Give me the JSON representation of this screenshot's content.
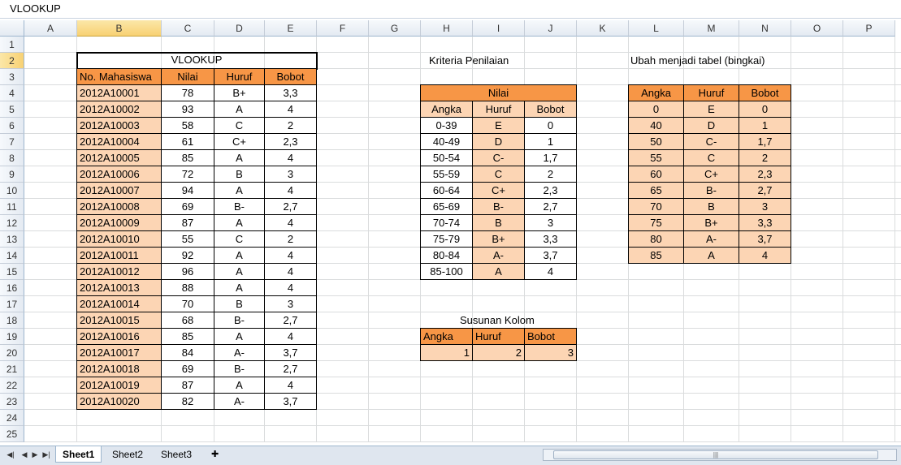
{
  "formula_bar": {
    "value": "VLOOKUP"
  },
  "columns": [
    "A",
    "B",
    "C",
    "D",
    "E",
    "F",
    "G",
    "H",
    "I",
    "J",
    "K",
    "L",
    "M",
    "N",
    "O",
    "P"
  ],
  "rows": [
    "1",
    "2",
    "3",
    "4",
    "5",
    "6",
    "7",
    "8",
    "9",
    "10",
    "11",
    "12",
    "13",
    "14",
    "15",
    "16",
    "17",
    "18",
    "19",
    "20",
    "21",
    "22",
    "23",
    "24",
    "25"
  ],
  "main_table": {
    "title": "VLOOKUP",
    "headers": [
      "No. Mahasiswa",
      "Nilai",
      "Huruf",
      "Bobot"
    ],
    "rows": [
      [
        "2012A10001",
        "78",
        "B+",
        "3,3"
      ],
      [
        "2012A10002",
        "93",
        "A",
        "4"
      ],
      [
        "2012A10003",
        "58",
        "C",
        "2"
      ],
      [
        "2012A10004",
        "61",
        "C+",
        "2,3"
      ],
      [
        "2012A10005",
        "85",
        "A",
        "4"
      ],
      [
        "2012A10006",
        "72",
        "B",
        "3"
      ],
      [
        "2012A10007",
        "94",
        "A",
        "4"
      ],
      [
        "2012A10008",
        "69",
        "B-",
        "2,7"
      ],
      [
        "2012A10009",
        "87",
        "A",
        "4"
      ],
      [
        "2012A10010",
        "55",
        "C",
        "2"
      ],
      [
        "2012A10011",
        "92",
        "A",
        "4"
      ],
      [
        "2012A10012",
        "96",
        "A",
        "4"
      ],
      [
        "2012A10013",
        "88",
        "A",
        "4"
      ],
      [
        "2012A10014",
        "70",
        "B",
        "3"
      ],
      [
        "2012A10015",
        "68",
        "B-",
        "2,7"
      ],
      [
        "2012A10016",
        "85",
        "A",
        "4"
      ],
      [
        "2012A10017",
        "84",
        "A-",
        "3,7"
      ],
      [
        "2012A10018",
        "69",
        "B-",
        "2,7"
      ],
      [
        "2012A10019",
        "87",
        "A",
        "4"
      ],
      [
        "2012A10020",
        "82",
        "A-",
        "3,7"
      ]
    ]
  },
  "criteria": {
    "title": "Kriteria Penilaian",
    "group_header": "Nilai",
    "headers": [
      "Angka",
      "Huruf",
      "Bobot"
    ],
    "rows": [
      [
        "0-39",
        "E",
        "0"
      ],
      [
        "40-49",
        "D",
        "1"
      ],
      [
        "50-54",
        "C-",
        "1,7"
      ],
      [
        "55-59",
        "C",
        "2"
      ],
      [
        "60-64",
        "C+",
        "2,3"
      ],
      [
        "65-69",
        "B-",
        "2,7"
      ],
      [
        "70-74",
        "B",
        "3"
      ],
      [
        "75-79",
        "B+",
        "3,3"
      ],
      [
        "80-84",
        "A-",
        "3,7"
      ],
      [
        "85-100",
        "A",
        "4"
      ]
    ]
  },
  "bordered_table": {
    "title": "Ubah menjadi tabel (bingkai)",
    "headers": [
      "Angka",
      "Huruf",
      "Bobot"
    ],
    "rows": [
      [
        "0",
        "E",
        "0"
      ],
      [
        "40",
        "D",
        "1"
      ],
      [
        "50",
        "C-",
        "1,7"
      ],
      [
        "55",
        "C",
        "2"
      ],
      [
        "60",
        "C+",
        "2,3"
      ],
      [
        "65",
        "B-",
        "2,7"
      ],
      [
        "70",
        "B",
        "3"
      ],
      [
        "75",
        "B+",
        "3,3"
      ],
      [
        "80",
        "A-",
        "3,7"
      ],
      [
        "85",
        "A",
        "4"
      ]
    ]
  },
  "column_order": {
    "title": "Susunan Kolom",
    "headers": [
      "Angka",
      "Huruf",
      "Bobot"
    ],
    "values": [
      "1",
      "2",
      "3"
    ]
  },
  "sheet_tabs": [
    "Sheet1",
    "Sheet2",
    "Sheet3"
  ],
  "colors": {
    "header_orange": "#f79646",
    "light_orange": "#fcd5b4",
    "selected_header": "#f8d173"
  }
}
